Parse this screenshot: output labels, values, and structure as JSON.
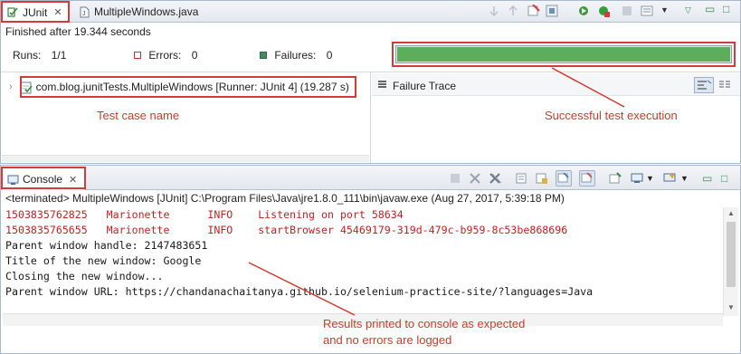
{
  "junit": {
    "tabs": [
      {
        "label": "JUnit"
      },
      {
        "label": "MultipleWindows.java"
      }
    ],
    "status": "Finished after 19.344 seconds",
    "runs_label": "Runs:",
    "runs_value": "1/1",
    "errors_label": "Errors:",
    "errors_value": "0",
    "failures_label": "Failures:",
    "failures_value": "0",
    "progress_fraction": 1.0,
    "test_row": "com.blog.junitTests.MultipleWindows [Runner: JUnit 4] (19.287 s)",
    "failure_trace_label": "Failure Trace"
  },
  "annotations": {
    "test_case_name": "Test case name",
    "successful": "Successful test execution",
    "console_line1": "Results printed to console as expected",
    "console_line2": "and no errors are logged"
  },
  "console": {
    "tab_label": "Console",
    "terminated": "<terminated> MultipleWindows [JUnit] C:\\Program Files\\Java\\jre1.8.0_111\\bin\\javaw.exe (Aug 27, 2017, 5:39:18 PM)",
    "lines": [
      {
        "text": "1503835762825   Marionette      INFO    Listening on port 58634",
        "level": "stderr"
      },
      {
        "text": "1503835765655   Marionette      INFO    startBrowser 45469179-319d-479c-b959-8c53be868696",
        "level": "stderr"
      },
      {
        "text": "Parent window handle: 2147483651",
        "level": "stdout"
      },
      {
        "text": "Title of the new window: Google",
        "level": "stdout"
      },
      {
        "text": "Closing the new window...",
        "level": "stdout"
      },
      {
        "text": "Parent window URL: https://chandanachaitanya.github.io/selenium-practice-site/?languages=Java",
        "level": "stdout"
      }
    ]
  },
  "colors": {
    "progress_green": "#5cad5c",
    "annotation_red": "#d33a2c",
    "stderr_red": "#c82121"
  }
}
